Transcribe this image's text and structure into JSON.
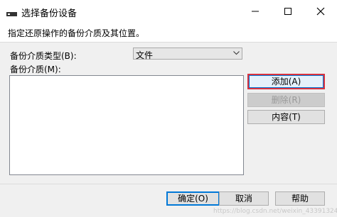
{
  "window": {
    "title": "选择备份设备",
    "icon": "database-icon",
    "controls": [
      "minimize-icon",
      "maximize-icon",
      "close-icon"
    ]
  },
  "instruction": "指定还原操作的备份介质及其位置。",
  "media_type": {
    "label": "备份介质类型(B):",
    "value": "文件"
  },
  "media_list": {
    "label": "备份介质(M):",
    "items": []
  },
  "side_buttons": {
    "add": "添加(A)",
    "remove": "删除(R)",
    "contents": "内容(T)"
  },
  "footer_buttons": {
    "ok": "确定(O)",
    "cancel": "取消",
    "help": "帮助"
  },
  "watermark": "https://blog.csdn.net/weixin_43391324",
  "colors": {
    "highlight_border": "#d9333f",
    "focus_blue": "#0078d7"
  }
}
